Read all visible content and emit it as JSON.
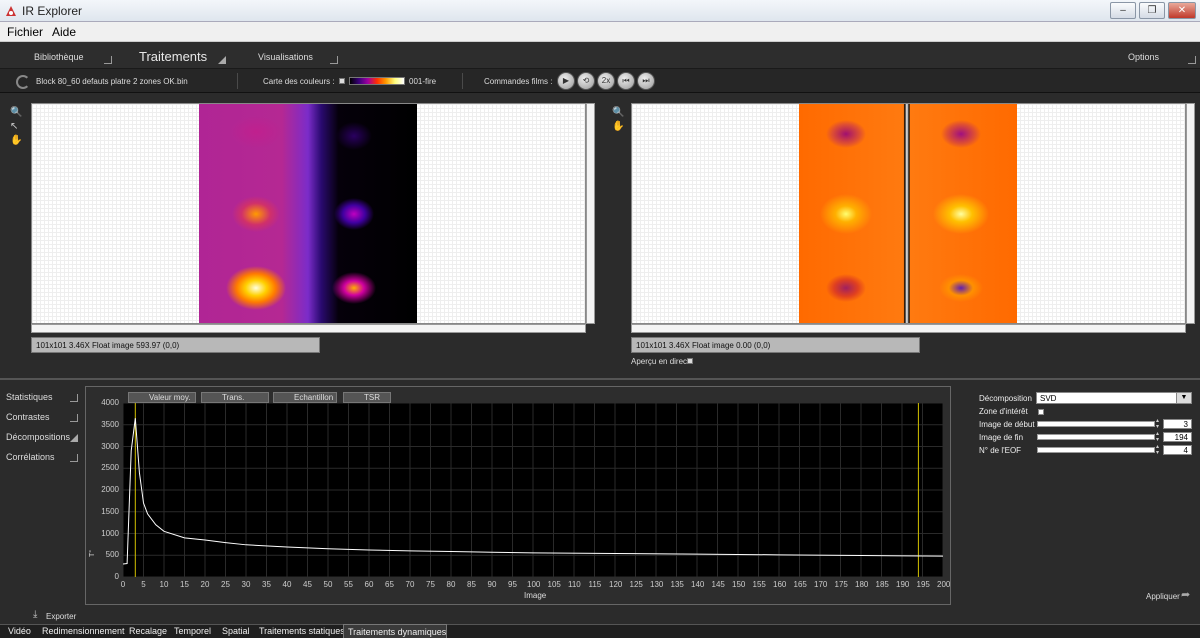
{
  "window": {
    "title": "IR Explorer",
    "min": "–",
    "restore": "❐",
    "close": "✕"
  },
  "menu": {
    "file": "Fichier",
    "help": "Aide"
  },
  "nav": {
    "library": "Bibliothèque",
    "treatments": "Traitements",
    "views": "Visualisations",
    "options": "Options"
  },
  "toolbar": {
    "filename": "Block 80_60 defauts platre 2 zones OK.bin",
    "colormap_label": "Carte des couleurs :",
    "colormap_name": "001-fire",
    "film_label": "Commandes films :",
    "film_buttons": [
      "▶",
      "⟲",
      "2x",
      "⏮",
      "⏭"
    ]
  },
  "left_view": {
    "status": "101x101 3.46X Float image 593.97     (0,0)"
  },
  "right_view": {
    "status": "101x101 3.46X Float image 0.00     (0,0)",
    "preview_label": "Aperçu en direct"
  },
  "side_menu": [
    "Statistiques",
    "Contrastes",
    "Décompositions",
    "Corrélations"
  ],
  "export_label": "Exporter",
  "legend": [
    "Valeur moy.",
    "Trans. Fourrier",
    "Echantillon",
    "TSR"
  ],
  "params": {
    "decomposition_label": "Décomposition",
    "decomposition_value": "SVD",
    "roi_label": "Zone d'intérêt",
    "start_label": "Image de début",
    "start_value": "3",
    "end_label": "Image de fin",
    "end_value": "194",
    "eof_label": "N° de l'EOF",
    "eof_value": "4",
    "apply": "Appliquer"
  },
  "bottom_tabs": [
    "Vidéo",
    "Redimensionnement",
    "Recalage",
    "Temporel",
    "Spatial",
    "Traitements statiques",
    "Traitements dynamiques"
  ],
  "colors": {
    "curve": "#ffffff",
    "marker": "#d4c200",
    "plot_bg": "#000000"
  },
  "chart_data": {
    "type": "line",
    "xlabel": "Image",
    "ylabel": "T°",
    "xlim": [
      0,
      200
    ],
    "ylim": [
      0,
      4000
    ],
    "x_ticks": [
      0,
      5,
      10,
      15,
      20,
      25,
      30,
      35,
      40,
      45,
      50,
      55,
      60,
      65,
      70,
      75,
      80,
      85,
      90,
      95,
      100,
      105,
      110,
      115,
      120,
      125,
      130,
      135,
      140,
      145,
      150,
      155,
      160,
      165,
      170,
      175,
      180,
      185,
      190,
      195,
      200
    ],
    "y_ticks": [
      0,
      500,
      1000,
      1500,
      2000,
      2500,
      3000,
      3500,
      4000
    ],
    "markers_x": [
      3,
      194
    ],
    "series": [
      {
        "name": "Valeur moy.",
        "x": [
          0,
          1,
          2,
          3,
          4,
          5,
          6,
          8,
          10,
          15,
          20,
          25,
          30,
          40,
          50,
          60,
          70,
          80,
          90,
          100,
          120,
          140,
          160,
          180,
          200
        ],
        "y": [
          300,
          310,
          2900,
          3650,
          2400,
          1700,
          1450,
          1200,
          1050,
          900,
          850,
          790,
          740,
          690,
          650,
          620,
          600,
          585,
          570,
          555,
          540,
          525,
          510,
          495,
          480
        ]
      }
    ]
  }
}
